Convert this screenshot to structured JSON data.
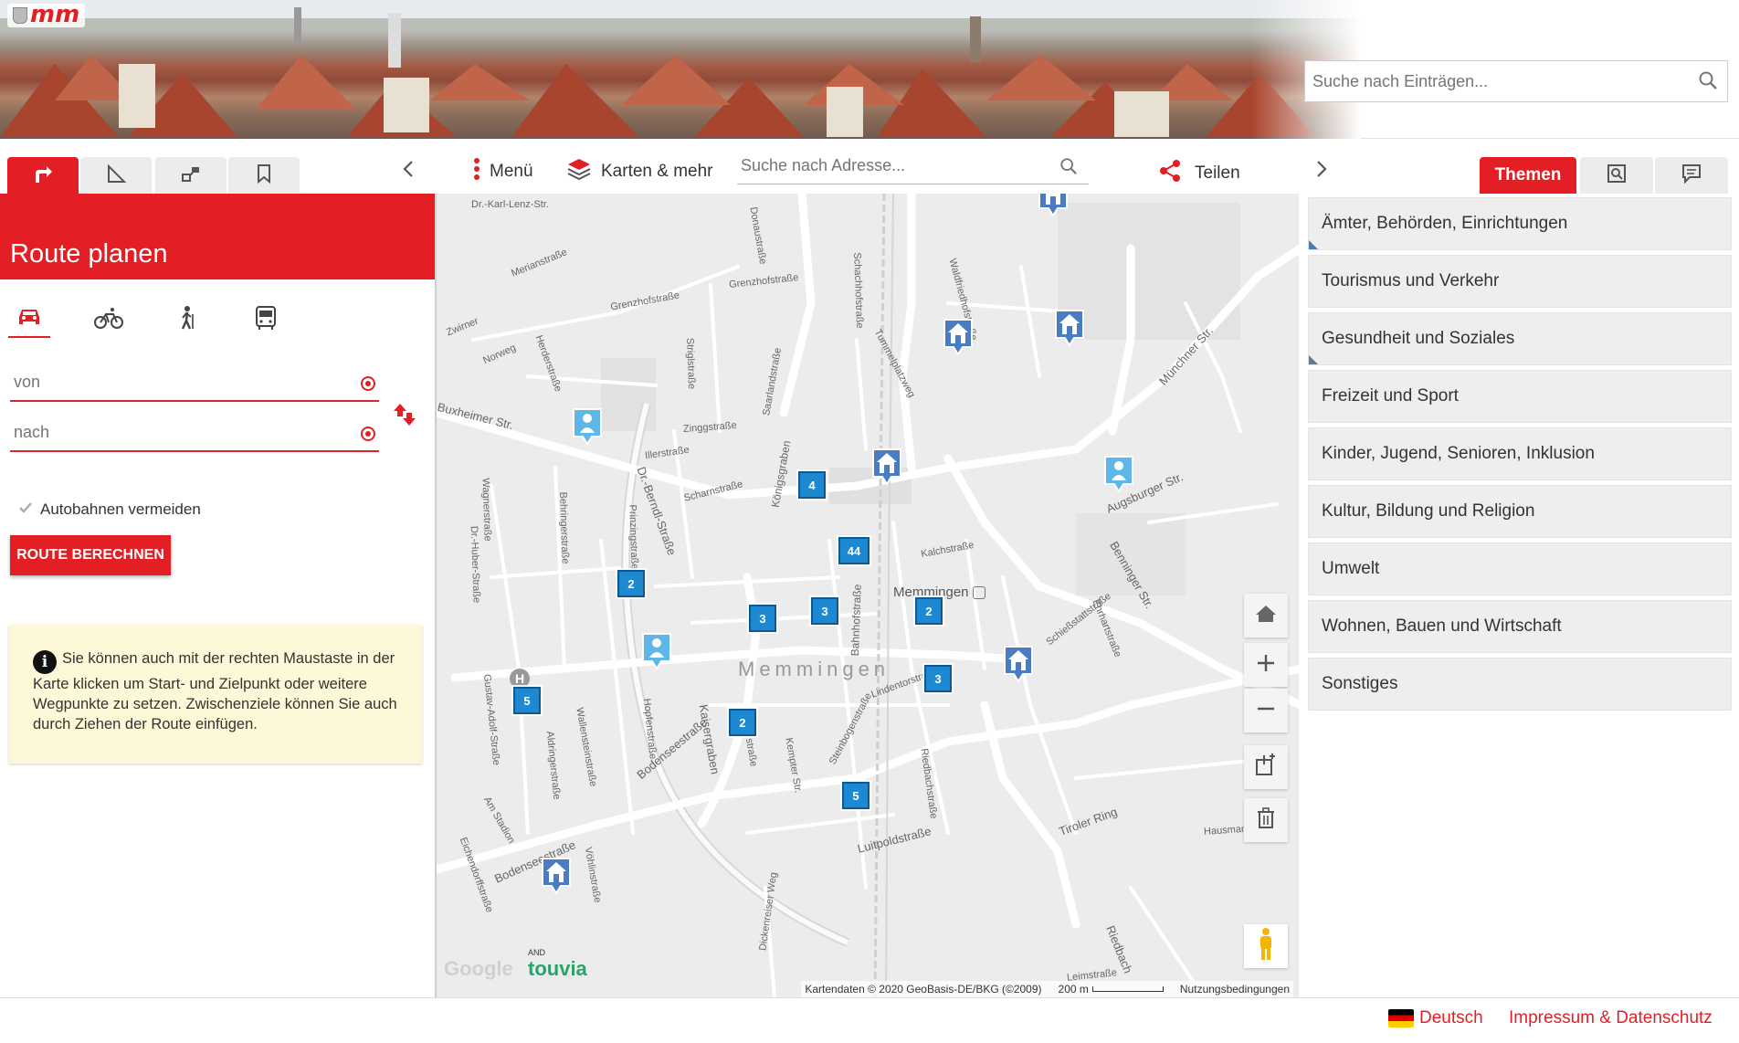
{
  "header": {
    "logo_text": "mm",
    "entry_search_placeholder": "Suche nach Einträgen..."
  },
  "left_tabs": [
    {
      "icon": "route-icon",
      "active": true
    },
    {
      "icon": "measure-icon",
      "active": false
    },
    {
      "icon": "layers-icon",
      "active": false
    },
    {
      "icon": "bookmark-icon",
      "active": false
    }
  ],
  "toolbar": {
    "menu_label": "Menü",
    "maps_label": "Karten & mehr",
    "address_placeholder": "Suche nach Adresse...",
    "share_label": "Teilen"
  },
  "right_tabs": {
    "themen_label": "Themen"
  },
  "route": {
    "title": "Route planen",
    "modes": [
      "car-icon",
      "bike-icon",
      "walk-icon",
      "bus-icon"
    ],
    "from_placeholder": "von",
    "to_placeholder": "nach",
    "avoid_highways_label": "Autobahnen vermeiden",
    "calculate_label": "ROUTE BERECHNEN",
    "info_text": "Sie können auch mit der rechten Maustaste in der Karte klicken um Start- und Zielpunkt oder weitere Wegpunkte zu setzen. Zwischenziele können Sie auch durch Ziehen der Route einfügen."
  },
  "map": {
    "city_label": "Memmingen",
    "station_label": "Memmingen",
    "clusters": [
      "4",
      "44",
      "2",
      "3",
      "3",
      "2",
      "2",
      "3",
      "5",
      "5"
    ],
    "street_labels": [
      "Dr.-Karl-Lenz-Str.",
      "Donaustraße",
      "Grenzhofstraße",
      "Grenzhofstraße",
      "Merianstraße",
      "Norweg",
      "Herderstraße",
      "Zwirner",
      "Striglstraße",
      "Zinggstraße",
      "Illerstraße",
      "Scharnstraße",
      "Königsgraben",
      "Dr.-Berndl-Straße",
      "Prinzingstraße",
      "Behringerstraße",
      "Wagnerstraße",
      "Dr.-Huber-Straße",
      "Schachhofstraße",
      "Tummelplatzweg",
      "Saarlandstraße",
      "Waldfriedhofstraße",
      "Münchner Str.",
      "Augsburger Str.",
      "Benninger Str.",
      "Bahnhofstraße",
      "Kalchstraße",
      "Lindentorstraße",
      "Kaisergraben",
      "Bodenseestraße",
      "Bodenseestraße",
      "Luitpoldstraße",
      "Tiroler Ring",
      "Hopfenstraße",
      "Weberstraße",
      "Kempter Str.",
      "Steinbogenstraße",
      "Riedbachstraße",
      "Am Stadion",
      "Gustav-Adolf-Straße",
      "Aldringerstraße",
      "Wallensteinstraße",
      "Vöhlinstraße",
      "Dickenreiser Weg",
      "Schießstattstraße",
      "Hausmannstraße",
      "Leimstraße",
      "Riedbach",
      "Ehrhartstraße",
      "Buxheimer Str.",
      "Eichendorffstraße"
    ],
    "attribution": "Kartendaten © 2020 GeoBasis-DE/BKG (©2009)",
    "scale_label": "200 m",
    "terms_label": "Nutzungsbedingungen",
    "google_label": "Google",
    "touvia_label": "touvia",
    "touvia_prefix": "AND",
    "hospital_label": "H"
  },
  "themes": [
    "Ämter, Behörden, Einrichtungen",
    "Tourismus und Verkehr",
    "Gesundheit und Soziales",
    "Freizeit und Sport",
    "Kinder, Jugend, Senioren, Inklusion",
    "Kultur, Bildung und Religion",
    "Umwelt",
    "Wohnen, Bauen und Wirtschaft",
    "Sonstiges"
  ],
  "footer": {
    "language_label": "Deutsch",
    "impressum_label": "Impressum & Datenschutz"
  },
  "colors": {
    "accent": "#e31e24",
    "cluster": "#1e88d0",
    "info_bg": "#fdf8d8",
    "theme_bg": "#eeeeee"
  }
}
